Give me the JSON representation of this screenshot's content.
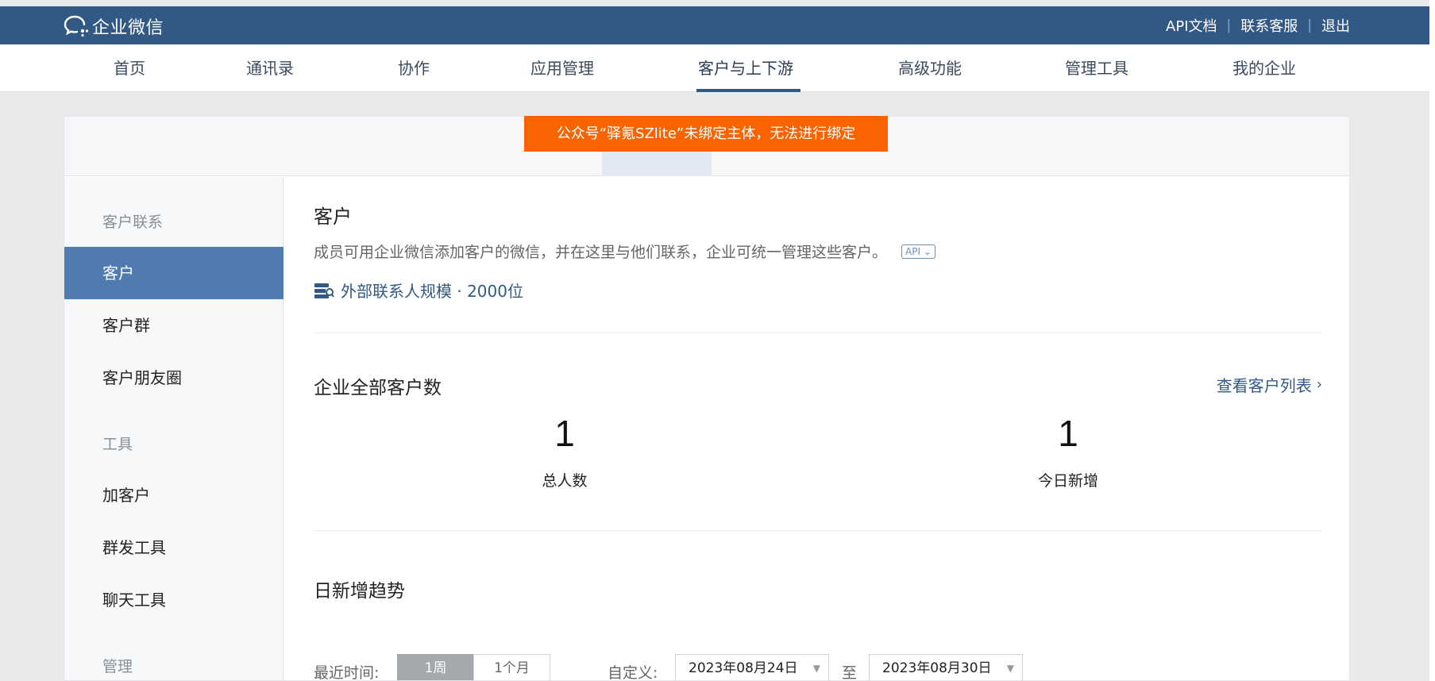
{
  "app": {
    "brand": "企业微信",
    "top_links": [
      "API文档",
      "联系客服",
      "退出"
    ]
  },
  "nav": {
    "items": [
      "首页",
      "通讯录",
      "协作",
      "应用管理",
      "客户与上下游",
      "高级功能",
      "管理工具",
      "我的企业"
    ],
    "active": "客户与上下游"
  },
  "toast": {
    "message": "公众号“驿氪SZlite”未绑定主体，无法进行绑定"
  },
  "sidebar": {
    "groups": [
      {
        "label": "客户联系",
        "items": [
          "客户",
          "客户群",
          "客户朋友圈"
        ]
      },
      {
        "label": "工具",
        "items": [
          "加客户",
          "群发工具",
          "聊天工具"
        ]
      },
      {
        "label": "管理",
        "items": []
      }
    ],
    "active": "客户"
  },
  "main": {
    "title": "客户",
    "description": "成员可用企业微信添加客户的微信，并在这里与他们联系，企业可统一管理这些客户。",
    "api_badge": "API",
    "scale_text": "外部联系人规模 · 2000位",
    "total_section": {
      "title": "企业全部客户数",
      "link": "查看客户列表",
      "stats": [
        {
          "value": "1",
          "label": "总人数"
        },
        {
          "value": "1",
          "label": "今日新增"
        }
      ]
    },
    "trend": {
      "title": "日新增趋势",
      "recent_label": "最近时间:",
      "periods": [
        "1周",
        "1个月"
      ],
      "active_period": "1周",
      "custom_label": "自定义:",
      "to_label": "至",
      "start_date": "2023年08月24日",
      "end_date": "2023年08月30日"
    }
  },
  "colors": {
    "topbar": "#325983",
    "accent": "#325983",
    "sidebar_active": "#4f7bb0",
    "toast": "#fa6400"
  }
}
